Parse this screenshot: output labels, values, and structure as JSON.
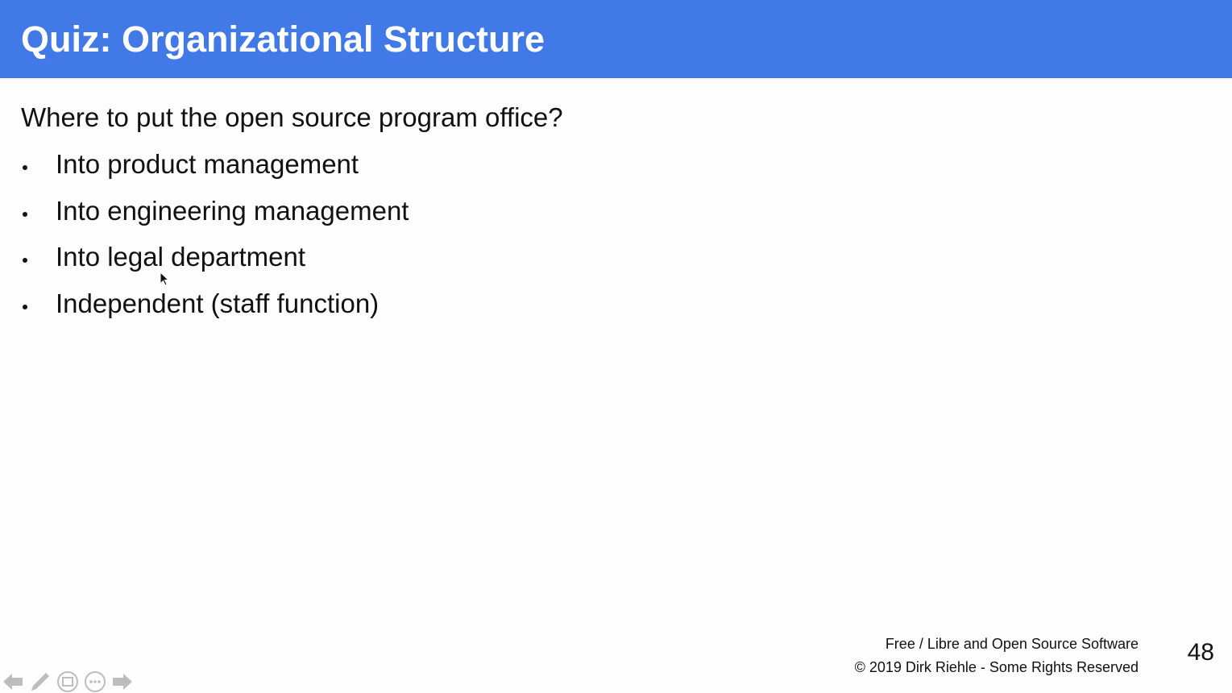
{
  "slide": {
    "title": "Quiz: Organizational Structure",
    "question": "Where to put the open source program office?",
    "bullets": [
      "Into product management",
      "Into engineering management",
      "Into legal department",
      "Independent (staff function)"
    ],
    "footer_line1": "Free / Libre and Open Source Software",
    "footer_line2": "© 2019 Dirk Riehle - Some Rights Reserved",
    "page_number": "48"
  },
  "nav": {
    "icons": [
      "previous-arrow-icon",
      "pen-icon",
      "slides-icon",
      "more-icon",
      "next-arrow-icon"
    ]
  },
  "colors": {
    "title_bar": "#4179e6",
    "title_text": "#ffffff",
    "background": "#fdfdfd",
    "text": "#111111"
  }
}
